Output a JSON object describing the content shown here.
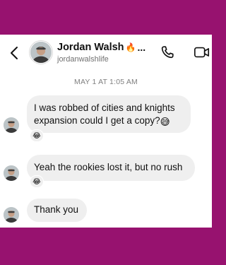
{
  "header": {
    "name": "Jordan Walsh",
    "name_emoji": "🔥",
    "overflow": "...",
    "handle": "jordanwalshlife",
    "icons": {
      "back": "chevron-left-icon",
      "call": "phone-icon",
      "video": "video-camera-icon"
    }
  },
  "timestamp": "MAY 1 AT 1:05 AM",
  "messages": [
    {
      "text": "I was robbed of cities and knights expansion could I get a copy?",
      "inline_emoji": "😅",
      "reaction": "😂"
    },
    {
      "text": "Yeah the rookies lost it, but no rush",
      "reaction": "😂"
    },
    {
      "text": "Thank you"
    }
  ],
  "colors": {
    "background": "#97126f",
    "bubble": "#efefef",
    "text": "#111111",
    "muted": "#808080"
  }
}
